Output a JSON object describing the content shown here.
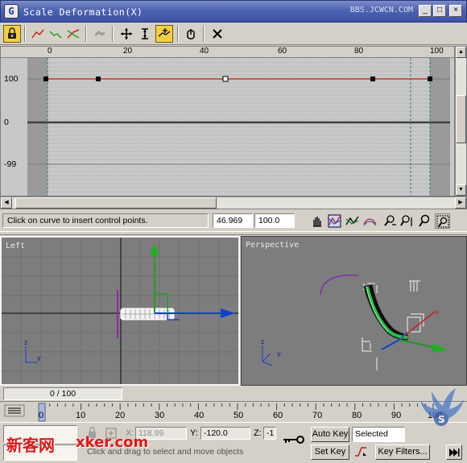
{
  "window": {
    "title": "Scale Deformation(X)",
    "watermark_url": "BBS.JCWCN.COM",
    "minimize_label": "_",
    "maximize_label": "□",
    "close_label": "×"
  },
  "toolbar": {
    "buttons": [
      {
        "icon": "lock-icon",
        "active": true
      },
      {
        "icon": "display-x-axis-icon"
      },
      {
        "icon": "display-y-axis-icon"
      },
      {
        "icon": "display-xy-axes-icon"
      },
      {
        "icon": "swap-curves-icon"
      },
      {
        "icon": "move-control-point-icon"
      },
      {
        "icon": "scale-control-point-icon"
      },
      {
        "icon": "insert-corner-point-icon",
        "active": true
      },
      {
        "icon": "delete-control-point-icon"
      },
      {
        "icon": "reset-curve-icon"
      }
    ]
  },
  "graph": {
    "ruler_labels": [
      "0",
      "20",
      "40",
      "60",
      "80",
      "100"
    ],
    "y_labels": [
      "100",
      "0",
      "-99"
    ],
    "curve_color": "#c0392b"
  },
  "status": {
    "message": "Click on curve to insert control points.",
    "x_value": "46.969",
    "y_value": "100.0",
    "nav_icons": [
      "pan-icon",
      "zoom-extents-icon",
      "zoom-horizontal-extents-icon",
      "zoom-vertical-extents-icon",
      "zoom-horizontally-icon",
      "zoom-vertically-icon",
      "zoom-icon",
      "zoom-region-icon"
    ]
  },
  "viewports": {
    "left_label": "Left",
    "perspective_label": "Perspective"
  },
  "timeline": {
    "frame_counter": "0 / 100",
    "track_labels": [
      "0",
      "10",
      "20",
      "30",
      "40",
      "50",
      "60",
      "70",
      "80",
      "90",
      "100"
    ]
  },
  "bottom": {
    "x_value": "118.99",
    "y_label": "Y:",
    "y_value": "-120.0",
    "z_label": "Z:",
    "z_value": "-1",
    "x_label": "X:",
    "prompt": "Click and drag to select and move objects",
    "auto_key": "Auto Key",
    "set_key": "Set Key",
    "selected": "Selected",
    "key_filters": "Key Filters..."
  },
  "watermarks": {
    "cn_text": "新客网",
    "site_text": "xker.com"
  }
}
